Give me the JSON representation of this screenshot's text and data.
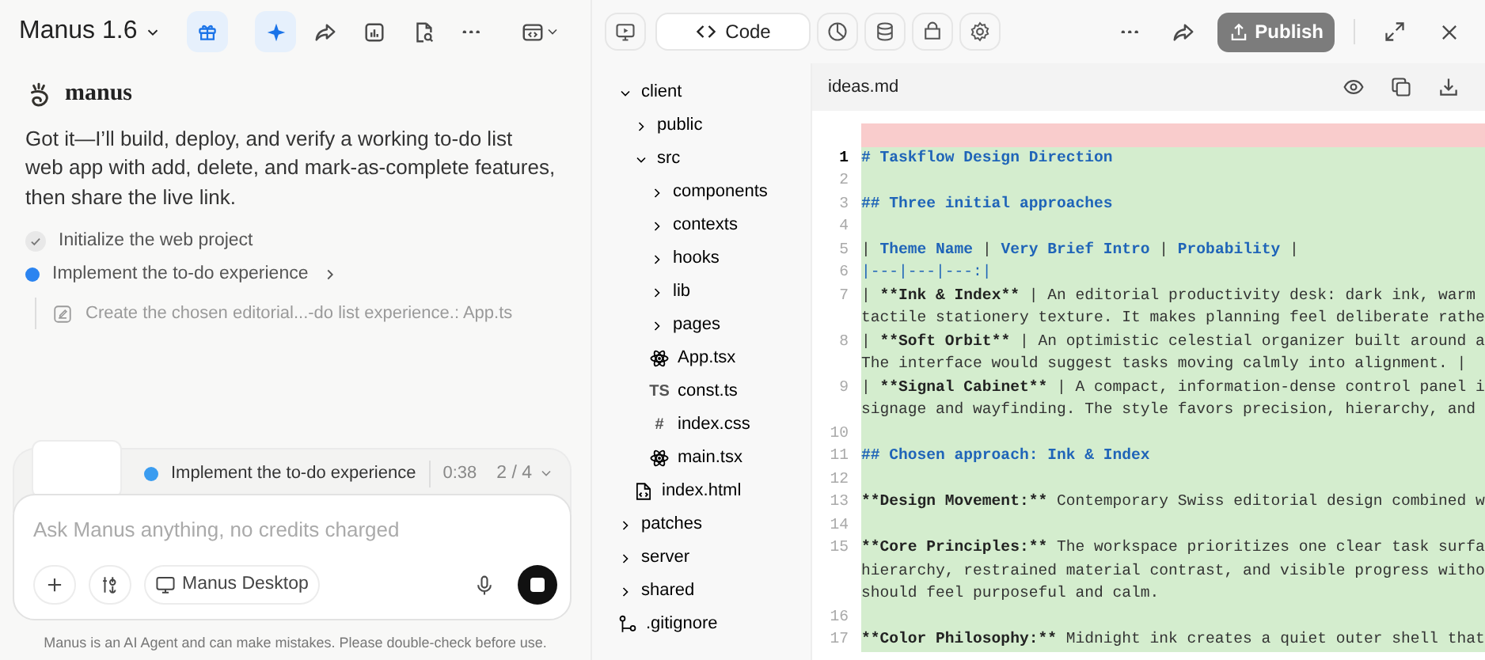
{
  "chat": {
    "model": "Manus 1.6",
    "toolbar": [
      {
        "kind": "sparkle",
        "selected": true
      },
      {
        "kind": "share",
        "selected": false
      },
      {
        "kind": "chart",
        "selected": false
      },
      {
        "kind": "doc-search",
        "selected": false
      },
      {
        "kind": "more",
        "selected": false
      },
      {
        "kind": "layout",
        "selected": false
      }
    ],
    "agent_name": "manus",
    "message": "Got it—I’ll build, deploy, and verify a working to-do list web app with add, delete, and mark-as-complete features, then share the live link.",
    "steps": [
      {
        "label": "Initialize the web project",
        "done": true
      },
      {
        "label": "Implement the to-do experience",
        "done": false,
        "substep": "Create the chosen editorial...-do list experience.: App.ts"
      }
    ],
    "progress": {
      "label": "Implement the to-do experience",
      "time": "0:38",
      "count": "2 / 4"
    },
    "input": {
      "placeholder": "Ask Manus anything, no credits charged",
      "target": "Manus Desktop"
    },
    "disclaimer": "Manus is an AI Agent and can make mistakes. Please double-check before use."
  },
  "workspace": {
    "tabs": [
      {
        "kind": "preview",
        "selected": false
      },
      {
        "kind": "code",
        "label": "Code",
        "selected": true
      },
      {
        "kind": "dashboard",
        "selected": false
      },
      {
        "kind": "database",
        "selected": false
      },
      {
        "kind": "files",
        "selected": false
      },
      {
        "kind": "settings",
        "selected": false
      }
    ],
    "publish": "Publish",
    "tree": [
      {
        "name": "client",
        "kind": "folder",
        "expanded": true,
        "children": [
          {
            "name": "public",
            "kind": "folder",
            "expanded": false
          },
          {
            "name": "src",
            "kind": "folder",
            "expanded": true,
            "children": [
              {
                "name": "components",
                "kind": "folder",
                "expanded": false
              },
              {
                "name": "contexts",
                "kind": "folder",
                "expanded": false
              },
              {
                "name": "hooks",
                "kind": "folder",
                "expanded": false
              },
              {
                "name": "lib",
                "kind": "folder",
                "expanded": false
              },
              {
                "name": "pages",
                "kind": "folder",
                "expanded": false
              },
              {
                "name": "App.tsx",
                "kind": "react"
              },
              {
                "name": "const.ts",
                "kind": "glyph",
                "glyph": "TS"
              },
              {
                "name": "index.css",
                "kind": "glyph",
                "glyph": "#"
              },
              {
                "name": "main.tsx",
                "kind": "react"
              }
            ]
          },
          {
            "name": "index.html",
            "kind": "html"
          }
        ]
      },
      {
        "name": "patches",
        "kind": "folder",
        "expanded": false
      },
      {
        "name": "server",
        "kind": "folder",
        "expanded": false
      },
      {
        "name": "shared",
        "kind": "folder",
        "expanded": false
      },
      {
        "name": ".gitignore",
        "kind": "git"
      }
    ],
    "file": "ideas.md",
    "deleted_band": true,
    "lines": [
      {
        "added": true,
        "number": "1",
        "active": true,
        "rows": [
          [
            {
              "text": "# Taskflow Design Direction",
              "kind": "heading"
            }
          ]
        ]
      },
      {
        "added": true,
        "number": "2",
        "active": false
      },
      {
        "added": true,
        "number": "3",
        "active": false,
        "rows": [
          [
            {
              "text": "## Three initial approaches",
              "kind": "heading"
            }
          ]
        ]
      },
      {
        "added": true,
        "number": "4",
        "active": false
      },
      {
        "added": true,
        "number": "5",
        "active": false,
        "rows": [
          [
            {
              "text": "| ",
              "kind": "plain"
            },
            {
              "text": "Theme Name",
              "kind": "heading"
            },
            {
              "text": " | ",
              "kind": "plain"
            },
            {
              "text": "Very Brief Intro",
              "kind": "heading"
            },
            {
              "text": " | ",
              "kind": "plain"
            },
            {
              "text": "Probability",
              "kind": "heading"
            },
            {
              "text": " |",
              "kind": "plain"
            }
          ]
        ]
      },
      {
        "added": true,
        "number": "6",
        "active": false,
        "rows": [
          [
            {
              "text": "|---|---|---:|",
              "kind": "link"
            }
          ]
        ]
      },
      {
        "added": true,
        "number": "7",
        "active": false,
        "rows": [
          [
            {
              "text": "| ",
              "kind": "plain"
            },
            {
              "text": "**Ink & Index**",
              "kind": "strong"
            },
            {
              "text": " | An editorial productivity desk: dark ink, warm",
              "kind": "plain"
            }
          ],
          [
            {
              "text": "tactile stationery texture. It makes planning feel deliberate rathe",
              "kind": "plain"
            }
          ]
        ]
      },
      {
        "added": true,
        "number": "8",
        "active": false,
        "rows": [
          [
            {
              "text": "| ",
              "kind": "plain"
            },
            {
              "text": "**Soft Orbit**",
              "kind": "strong"
            },
            {
              "text": " | An optimistic celestial organizer built around a",
              "kind": "plain"
            }
          ],
          [
            {
              "text": "The interface would suggest tasks moving calmly into alignment. |",
              "kind": "plain"
            }
          ]
        ]
      },
      {
        "added": true,
        "number": "9",
        "active": false,
        "rows": [
          [
            {
              "text": "| ",
              "kind": "plain"
            },
            {
              "text": "**Signal Cabinet**",
              "kind": "strong"
            },
            {
              "text": " | A compact, information-dense control panel i",
              "kind": "plain"
            }
          ],
          [
            {
              "text": "signage and wayfinding. The style favors precision, hierarchy, and",
              "kind": "plain"
            }
          ]
        ]
      },
      {
        "added": true,
        "number": "10",
        "active": false
      },
      {
        "added": true,
        "number": "11",
        "active": false,
        "rows": [
          [
            {
              "text": "## Chosen approach: Ink & Index",
              "kind": "heading"
            }
          ]
        ]
      },
      {
        "added": true,
        "number": "12",
        "active": false
      },
      {
        "added": true,
        "number": "13",
        "active": false,
        "rows": [
          [
            {
              "text": "**Design Movement:**",
              "kind": "strong"
            },
            {
              "text": " Contemporary Swiss editorial design combined w",
              "kind": "plain"
            }
          ]
        ]
      },
      {
        "added": true,
        "number": "14",
        "active": false
      },
      {
        "added": true,
        "number": "15",
        "active": false,
        "rows": [
          [
            {
              "text": "**Core Principles:**",
              "kind": "strong"
            },
            {
              "text": " The workspace prioritizes one clear task surfa",
              "kind": "plain"
            }
          ],
          [
            {
              "text": "hierarchy, restrained material contrast, and visible progress witho",
              "kind": "plain"
            }
          ],
          [
            {
              "text": "should feel purposeful and calm.",
              "kind": "plain"
            }
          ]
        ]
      },
      {
        "added": true,
        "number": "16",
        "active": false
      },
      {
        "added": true,
        "number": "17",
        "active": false,
        "rows": [
          [
            {
              "text": "**Color Philosophy:**",
              "kind": "strong"
            },
            {
              "text": " Midnight ink creates a quiet outer shell that",
              "kind": "plain"
            }
          ]
        ]
      }
    ]
  }
}
